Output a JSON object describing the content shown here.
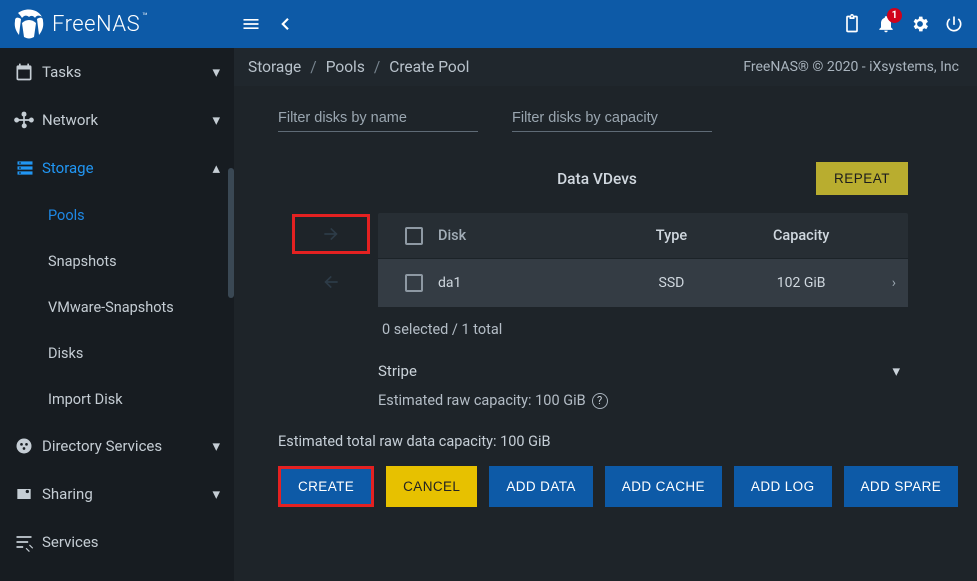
{
  "app": {
    "name": "FreeNAS",
    "tm": "™"
  },
  "topbar": {
    "notification_count": "1"
  },
  "sidebar": {
    "items": [
      {
        "label": "Tasks"
      },
      {
        "label": "Network"
      },
      {
        "label": "Storage"
      },
      {
        "label": "Directory Services"
      },
      {
        "label": "Sharing"
      },
      {
        "label": "Services"
      }
    ],
    "storage_sub": [
      {
        "label": "Pools"
      },
      {
        "label": "Snapshots"
      },
      {
        "label": "VMware-Snapshots"
      },
      {
        "label": "Disks"
      },
      {
        "label": "Import Disk"
      }
    ]
  },
  "breadcrumb": {
    "a": "Storage",
    "b": "Pools",
    "c": "Create Pool"
  },
  "copyright": "FreeNAS® © 2020 - iXsystems, Inc",
  "filters": {
    "name_placeholder": "Filter disks by name",
    "capacity_placeholder": "Filter disks by capacity"
  },
  "vdev": {
    "title": "Data VDevs",
    "repeat": "REPEAT",
    "columns": {
      "disk": "Disk",
      "type": "Type",
      "capacity": "Capacity"
    },
    "rows": [
      {
        "disk": "da1",
        "type": "SSD",
        "capacity": "102 GiB"
      }
    ],
    "selection": "0 selected / 1 total",
    "layout": "Stripe",
    "est_label": "Estimated raw capacity: 100 GiB"
  },
  "total_label": "Estimated total raw data capacity: 100 GiB",
  "actions": {
    "create": "CREATE",
    "cancel": "CANCEL",
    "add_data": "ADD DATA",
    "add_cache": "ADD CACHE",
    "add_log": "ADD LOG",
    "add_spare": "ADD SPARE"
  }
}
